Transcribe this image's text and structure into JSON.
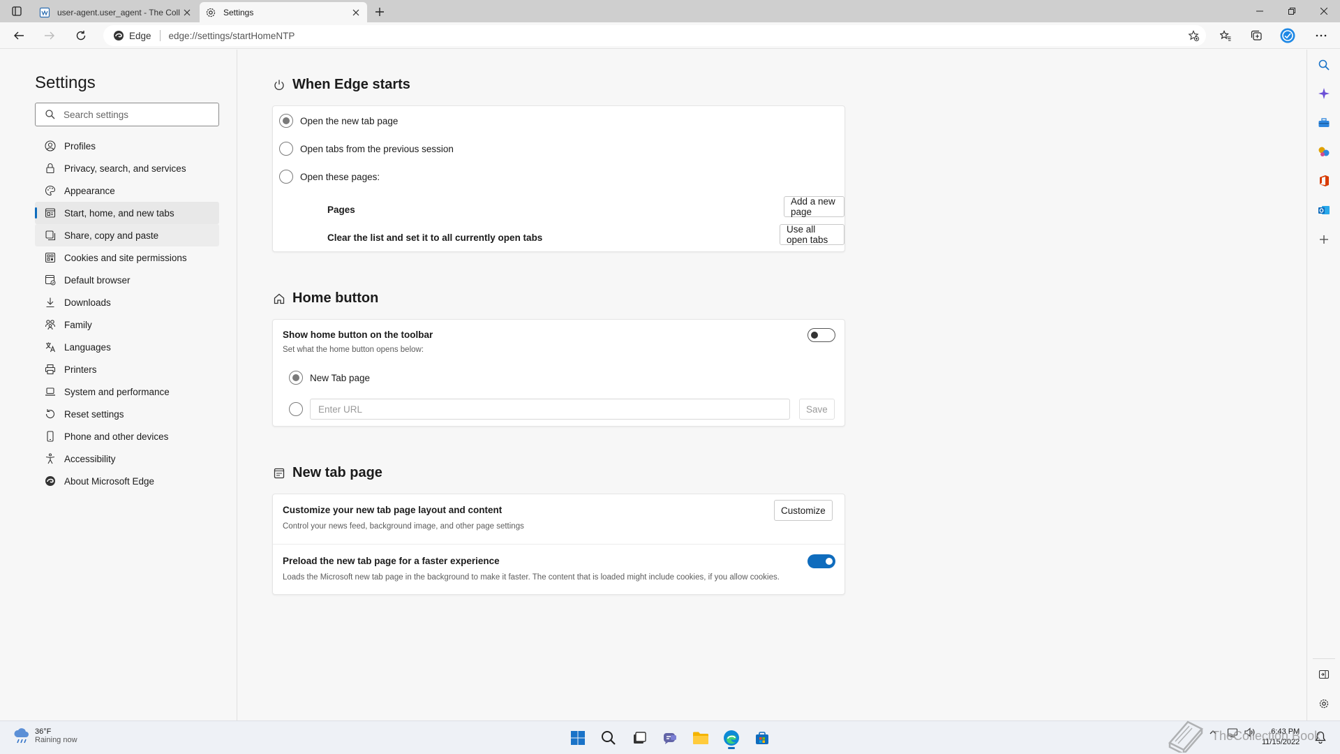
{
  "tabs": [
    {
      "title": "user-agent.user_agent - The Coll",
      "active": false
    },
    {
      "title": "Settings",
      "active": true
    }
  ],
  "toolbar": {
    "brand": "Edge",
    "url": "edge://settings/startHomeNTP"
  },
  "nav": {
    "title": "Settings",
    "search_placeholder": "Search settings",
    "items": [
      {
        "label": "Profiles",
        "icon": "profile-icon"
      },
      {
        "label": "Privacy, search, and services",
        "icon": "lock-icon"
      },
      {
        "label": "Appearance",
        "icon": "palette-icon"
      },
      {
        "label": "Start, home, and new tabs",
        "icon": "window-icon",
        "selected": true
      },
      {
        "label": "Share, copy and paste",
        "icon": "share-icon"
      },
      {
        "label": "Cookies and site permissions",
        "icon": "permissions-icon"
      },
      {
        "label": "Default browser",
        "icon": "browser-icon"
      },
      {
        "label": "Downloads",
        "icon": "download-icon"
      },
      {
        "label": "Family",
        "icon": "family-icon"
      },
      {
        "label": "Languages",
        "icon": "language-icon"
      },
      {
        "label": "Printers",
        "icon": "printer-icon"
      },
      {
        "label": "System and performance",
        "icon": "laptop-icon"
      },
      {
        "label": "Reset settings",
        "icon": "reset-icon"
      },
      {
        "label": "Phone and other devices",
        "icon": "phone-icon"
      },
      {
        "label": "Accessibility",
        "icon": "accessibility-icon"
      },
      {
        "label": "About Microsoft Edge",
        "icon": "edge-icon"
      }
    ]
  },
  "when_edge_starts": {
    "title": "When Edge starts",
    "options": [
      {
        "label": "Open the new tab page",
        "selected": true
      },
      {
        "label": "Open tabs from the previous session",
        "selected": false
      },
      {
        "label": "Open these pages:",
        "selected": false
      }
    ],
    "pages_label": "Pages",
    "add_page_button": "Add a new page",
    "clear_label": "Clear the list and set it to all currently open tabs",
    "use_all_button": "Use all open tabs"
  },
  "home_button": {
    "title": "Home button",
    "show_label": "Show home button on the toolbar",
    "show_enabled": false,
    "sub_label": "Set what the home button opens below:",
    "new_tab_option": "New Tab page",
    "url_placeholder": "Enter URL",
    "save_button": "Save"
  },
  "new_tab_page": {
    "title": "New tab page",
    "customize_title": "Customize your new tab page layout and content",
    "customize_desc": "Control your news feed, background image, and other page settings",
    "customize_button": "Customize",
    "preload_title": "Preload the new tab page for a faster experience",
    "preload_desc": "Loads the Microsoft new tab page in the background to make it faster. The content that is loaded might include cookies, if you allow cookies.",
    "preload_enabled": true
  },
  "taskbar": {
    "weather_temp": "36°F",
    "weather_cond": "Raining now",
    "time": "6:43 PM",
    "date": "11/15/2022",
    "watermark": "TheCollection Book"
  },
  "colors": {
    "accent": "#0f6cbd",
    "tabstrip": "#cfcfcf",
    "background": "#f7f7f7"
  }
}
